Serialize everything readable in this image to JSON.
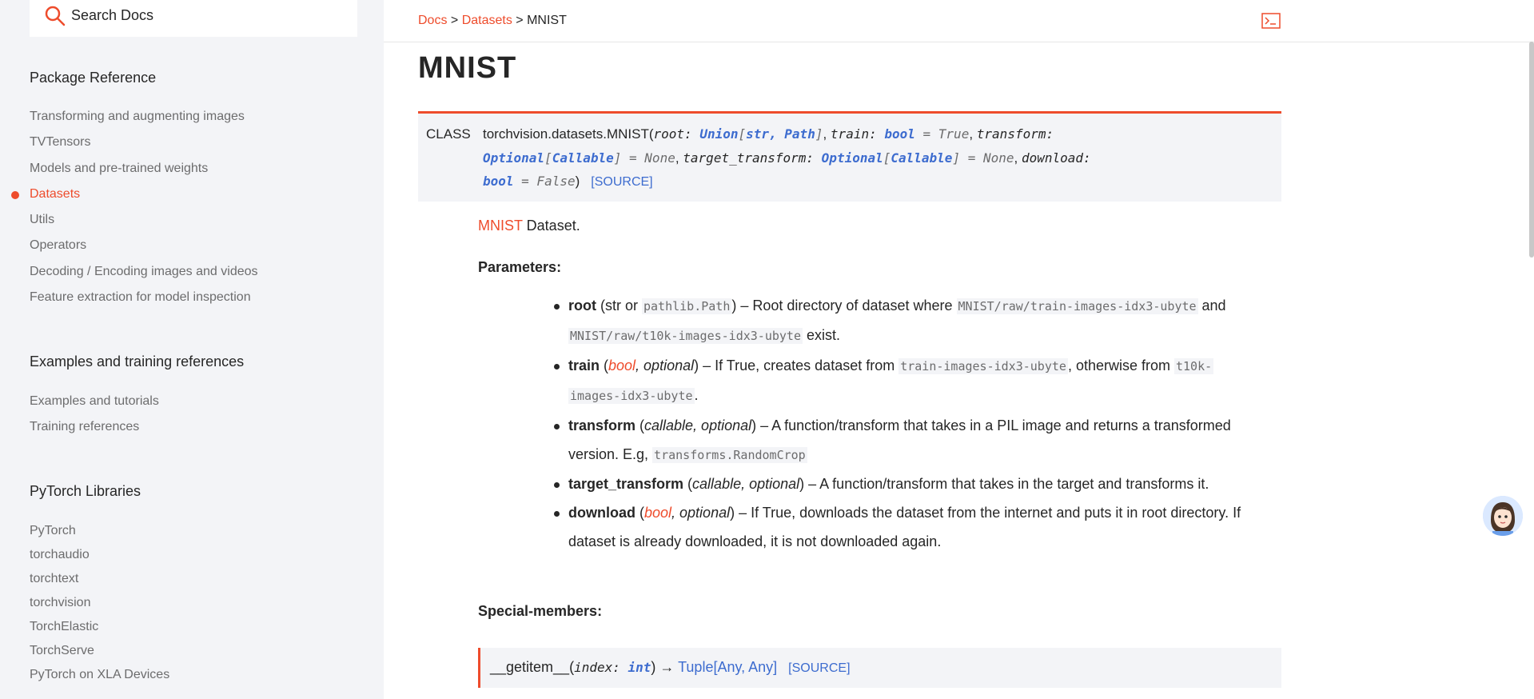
{
  "sidebar": {
    "search_placeholder": "Search Docs",
    "sections": [
      {
        "heading": "Package Reference",
        "items": [
          "Transforming and augmenting images",
          "TVTensors",
          "Models and pre-trained weights",
          "Datasets",
          "Utils",
          "Operators",
          "Decoding / Encoding images and videos",
          "Feature extraction for model inspection"
        ],
        "active": "Datasets"
      },
      {
        "heading": "Examples and training references",
        "items": [
          "Examples and tutorials",
          "Training references"
        ]
      },
      {
        "heading": "PyTorch Libraries",
        "items": [
          "PyTorch",
          "torchaudio",
          "torchtext",
          "torchvision",
          "TorchElastic",
          "TorchServe",
          "PyTorch on XLA Devices"
        ]
      }
    ]
  },
  "breadcrumb": {
    "docs": "Docs",
    "datasets": "Datasets",
    "current": "MNIST",
    "sep": ">"
  },
  "title": "MNIST",
  "signature": {
    "class_label": "CLASS",
    "name": "torchvision.datasets.MNIST(",
    "source_label": "[SOURCE]"
  },
  "description": {
    "link": "MNIST",
    "rest": " Dataset."
  },
  "parameters_heading": "Parameters:",
  "parameters": {
    "root": {
      "name": "root",
      "type_open": " (str or ",
      "type_code": "pathlib.Path",
      "type_close": ") – Root directory of dataset where ",
      "code1": "MNIST/raw/train-images-idx3-ubyte",
      "and": " and",
      "code2": "MNIST/raw/t10k-images-idx3-ubyte",
      "end": " exist."
    },
    "train": {
      "name": "train",
      "type": "bool",
      "optional": ", optional",
      "desc": ") – If True, creates dataset from ",
      "code1": "train-images-idx3-ubyte",
      "mid": ", otherwise from ",
      "code2a": "t10k-",
      "code2b": "images-idx3-ubyte",
      "end": "."
    },
    "transform": {
      "name": "transform",
      "type": "callable, optional",
      "desc": ") – A function/transform that takes in a PIL image and returns a transformed",
      "desc2": "version. E.g, ",
      "code": "transforms.RandomCrop"
    },
    "target_transform": {
      "name": "target_transform",
      "type": "callable, optional",
      "desc": ") – A function/transform that takes in the target and transforms it."
    },
    "download": {
      "name": "download",
      "type": "bool",
      "optional": ", optional",
      "desc": ") – If True, downloads the dataset from the internet and puts it in root directory. If",
      "desc2": "dataset is already downloaded, it is not downloaded again."
    }
  },
  "special_members_heading": "Special-members:",
  "member": {
    "name": "__getitem__(",
    "arg": "index: ",
    "arg_type": "int",
    "close": ") → ",
    "ret": "Tuple",
    "ret_args": "[Any, Any]",
    "source": "[SOURCE]"
  }
}
